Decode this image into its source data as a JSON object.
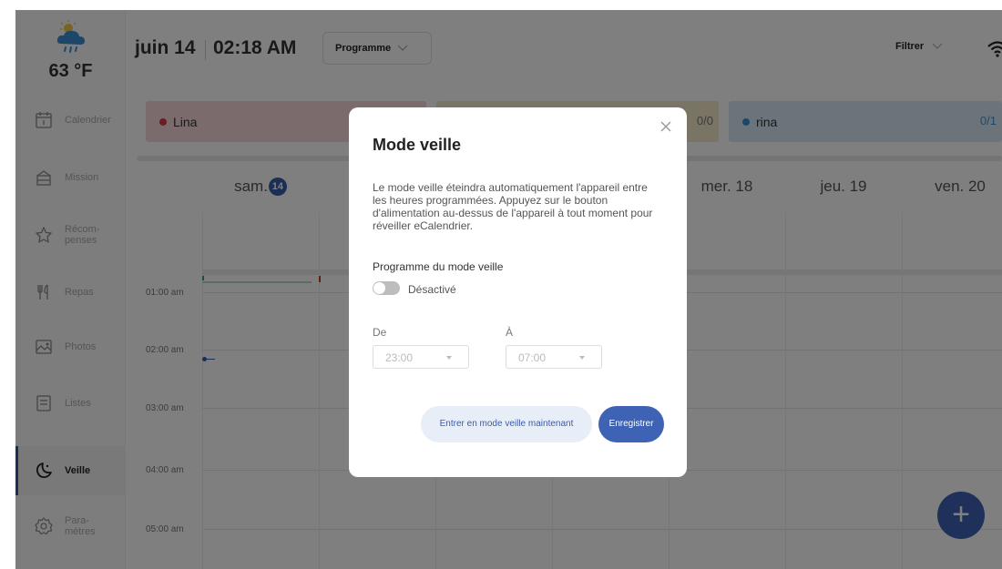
{
  "weather": {
    "temperature": "63 °F",
    "icon": "cloud-rain-sun-icon"
  },
  "sidebar": {
    "items": [
      {
        "label": "Calendrier",
        "icon": "calendar-icon"
      },
      {
        "label": "Mission",
        "icon": "mission-icon"
      },
      {
        "label": "Récom-\npenses",
        "icon": "reward-icon"
      },
      {
        "label": "Repas",
        "icon": "utensils-icon"
      },
      {
        "label": "Photos",
        "icon": "photo-icon"
      },
      {
        "label": "Listes",
        "icon": "list-icon"
      },
      {
        "label": "Veille",
        "icon": "moon-icon",
        "active": true
      },
      {
        "label": "Para-\nmètres",
        "icon": "settings-icon"
      }
    ]
  },
  "header": {
    "date": "juin 14",
    "time": "02:18 AM",
    "view_dropdown": "Programme",
    "filter": "Filtrer",
    "wifi_icon": "wifi-icon"
  },
  "people": [
    {
      "name": "Lina",
      "count": "",
      "color": "#d73a4a"
    },
    {
      "name": "",
      "count": "0/0",
      "color": "#e8c45a"
    },
    {
      "name": "rina",
      "count": "0/1",
      "color": "#3b8fd3"
    }
  ],
  "calendar": {
    "days": [
      {
        "label": "sam.",
        "num": "14"
      },
      {
        "label": "",
        "num": ""
      },
      {
        "label": "",
        "num": ""
      },
      {
        "label": "",
        "num": ""
      },
      {
        "label": "mer. 18",
        "num": ""
      },
      {
        "label": "jeu. 19",
        "num": ""
      },
      {
        "label": "ven. 20",
        "num": ""
      }
    ],
    "hours": [
      "01:00 am",
      "02:00 am",
      "03:00 am",
      "04:00 am",
      "05:00 am"
    ]
  },
  "modal": {
    "title": "Mode veille",
    "description": "Le mode veille éteindra automatiquement l'appareil entre les heures programmées. Appuyez sur le bouton d'alimentation au-dessus de l'appareil à tout moment pour réveiller eCalendrier.",
    "section_label": "Programme du mode veille",
    "toggle_label": "Désactivé",
    "from_label": "De",
    "to_label": "À",
    "from_value": "23:00",
    "to_value": "07:00",
    "sleep_now_button": "Entrer en mode veille maintenant",
    "save_button": "Enregistrer"
  },
  "colors": {
    "accent": "#3e63b4",
    "active_bar": "#3b5ca8"
  }
}
